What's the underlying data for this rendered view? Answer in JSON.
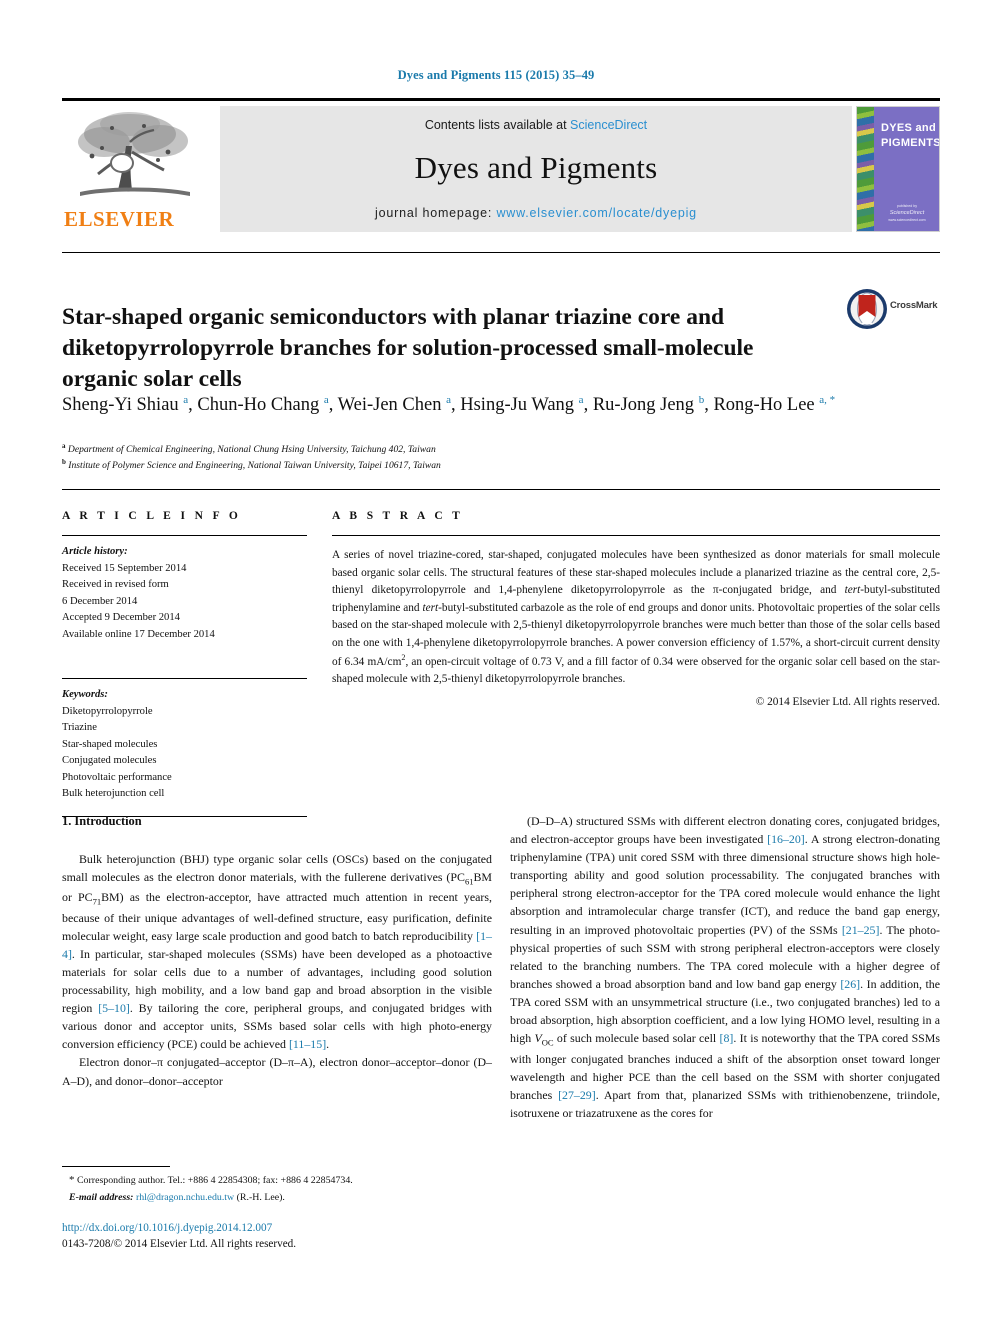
{
  "running_head": "Dyes and Pigments 115 (2015) 35–49",
  "masthead": {
    "contents_prefix": "Contents lists available at ",
    "sciencedirect": "ScienceDirect",
    "journal_name": "Dyes and Pigments",
    "homepage_prefix": "journal homepage: ",
    "homepage_url": "www.elsevier.com/locate/dyepig",
    "publisher": "ELSEVIER",
    "cover_title": "DYES and PIGMENTS",
    "cover_footer_prefix": "published by",
    "cover_footer_brand": "ScienceDirect",
    "cover_footer_sub": "www.sciencedirect.com",
    "link_color": "#2a8fd0"
  },
  "article": {
    "title": "Star-shaped organic semiconductors with planar triazine core and diketopyrrolopyrrole branches for solution-processed small-molecule organic solar cells",
    "crossmark_label": "CrossMark",
    "authors": [
      {
        "name": "Sheng-Yi Shiau",
        "marks": "a"
      },
      {
        "name": "Chun-Ho Chang",
        "marks": "a"
      },
      {
        "name": "Wei-Jen Chen",
        "marks": "a"
      },
      {
        "name": "Hsing-Ju Wang",
        "marks": "a"
      },
      {
        "name": "Ru-Jong Jeng",
        "marks": "b"
      },
      {
        "name": "Rong-Ho Lee",
        "marks": "a, *"
      }
    ],
    "affiliations": [
      {
        "mark": "a",
        "text": "Department of Chemical Engineering, National Chung Hsing University, Taichung 402, Taiwan"
      },
      {
        "mark": "b",
        "text": "Institute of Polymer Science and Engineering, National Taiwan University, Taipei 10617, Taiwan"
      }
    ]
  },
  "article_info": {
    "heading": "A R T I C L E  I N F O",
    "history_title": "Article history:",
    "history": [
      "Received 15 September 2014",
      "Received in revised form",
      "6 December 2014",
      "Accepted 9 December 2014",
      "Available online 17 December 2014"
    ],
    "keywords_title": "Keywords:",
    "keywords": [
      "Diketopyrrolopyrrole",
      "Triazine",
      "Star-shaped molecules",
      "Conjugated molecules",
      "Photovoltaic performance",
      "Bulk heterojunction cell"
    ]
  },
  "abstract": {
    "heading": "A B S T R A C T",
    "paragraph_1": "A series of novel triazine-cored, star-shaped, conjugated molecules have been synthesized as donor materials for small molecule based organic solar cells. The structural features of these star-shaped molecules include a planarized triazine as the central core, 2,5-thienyl diketopyrrolopyrrole and 1,4-phenylene diketopyrrolopyrrole as the π-conjugated bridge, and ",
    "tert_1": "tert",
    "paragraph_2": "-butyl-substituted triphenylamine and ",
    "tert_2": "tert",
    "paragraph_3": "-butyl-substituted carbazole as the role of end groups and donor units. Photovoltaic properties of the solar cells based on the star-shaped molecule with 2,5-thienyl diketopyrrolopyrrole branches were much better than those of the solar cells based on the one with 1,4-phenylene diketopyrrolopyrrole branches. A power conversion efficiency of 1.57%, a short-circuit current density of 6.34 mA/cm",
    "superscript_2": "2",
    "paragraph_4": ", an open-circuit voltage of 0.73 V, and a fill factor of 0.34 were observed for the organic solar cell based on the star-shaped molecule with 2,5-thienyl diketopyrrolopyrrole branches.",
    "copyright": "© 2014 Elsevier Ltd. All rights reserved."
  },
  "introduction": {
    "heading": "1.  Introduction",
    "left_p1_a": "Bulk heterojunction (BHJ) type organic solar cells (OSCs) based on the conjugated small molecules as the electron donor materials, with the fullerene derivatives (PC",
    "left_p1_sub1": "61",
    "left_p1_b": "BM or PC",
    "left_p1_sub2": "71",
    "left_p1_c": "BM) as the electron-acceptor, have attracted much attention in recent years, because of their unique advantages of well-defined structure, easy purification, definite molecular weight, easy large scale production and good batch to batch reproducibility ",
    "left_p1_ref1": "[1–4]",
    "left_p1_d": ". In particular, star-shaped molecules (SSMs) have been developed as a photoactive materials for solar cells due to a number of advantages, including good solution processability, high mobility, and a low band gap and broad absorption in the visible region ",
    "left_p1_ref2": "[5–10]",
    "left_p1_e": ". By tailoring the core, peripheral groups, and conjugated bridges with various donor and acceptor units, SSMs based solar cells with high photo-energy conversion efficiency (PCE) could be achieved ",
    "left_p1_ref3": "[11–15]",
    "left_p1_f": ".",
    "left_p2": "Electron donor–π conjugated–acceptor (D–π–A), electron donor–acceptor–donor (D–A–D), and donor–donor–acceptor",
    "right_p1_a": "(D–D–A) structured SSMs with different electron donating cores, conjugated bridges, and electron-acceptor groups have been investigated ",
    "right_p1_ref1": "[16–20]",
    "right_p1_b": ". A strong electron-donating triphenylamine (TPA) unit cored SSM with three dimensional structure shows high hole-transporting ability and good solution processability. The conjugated branches with peripheral strong electron-acceptor for the TPA cored molecule would enhance the light absorption and intramolecular charge transfer (ICT), and reduce the band gap energy, resulting in an improved photovoltaic properties (PV) of the SSMs ",
    "right_p1_ref2": "[21–25]",
    "right_p1_c": ". The photo-physical properties of such SSM with strong peripheral electron-acceptors were closely related to the branching numbers. The TPA cored molecule with a higher degree of branches showed a broad absorption band and low band gap energy ",
    "right_p1_ref3": "[26]",
    "right_p1_d": ". In addition, the TPA cored SSM with an unsymmetrical structure (i.e., two conjugated branches) led to a broad absorption, high absorption coefficient, and a low lying HOMO level, resulting in a high ",
    "right_p1_voc": "V",
    "right_p1_voc_sub": "OC",
    "right_p1_e": " of such molecule based solar cell ",
    "right_p1_ref4": "[8]",
    "right_p1_f": ". It is noteworthy that the TPA cored SSMs with longer conjugated branches induced a shift of the absorption onset toward longer wavelength and higher PCE than the cell based on the SSM with shorter conjugated branches ",
    "right_p1_ref5": "[27–29]",
    "right_p1_g": ". Apart from that, planarized SSMs with trithienobenzene, triindole, isotruxene or triazatruxene as the cores for"
  },
  "footer": {
    "corresponding_star": "*",
    "corresponding": " Corresponding author. Tel.: +886 4 22854308; fax: +886 4 22854734.",
    "email_label": "E-mail address:",
    "email": "rhl@dragon.nchu.edu.tw",
    "email_suffix": " (R.-H. Lee).",
    "doi": "http://dx.doi.org/10.1016/j.dyepig.2014.12.007",
    "issn": "0143-7208/© 2014 Elsevier Ltd. All rights reserved."
  }
}
